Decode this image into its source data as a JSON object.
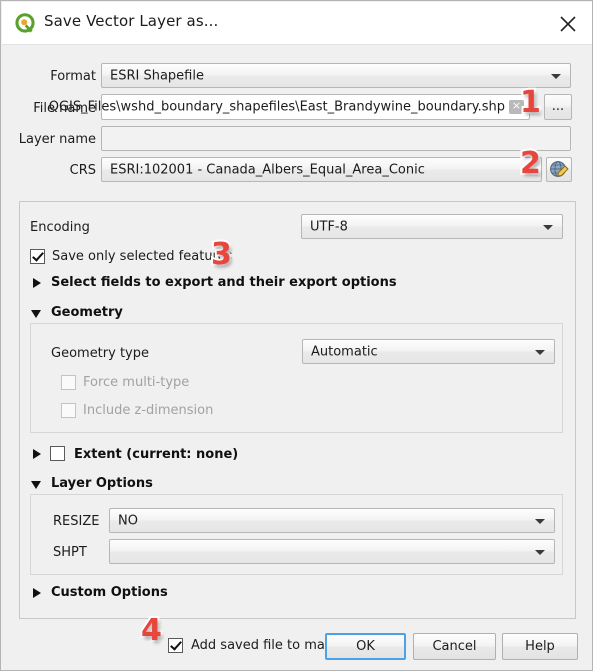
{
  "window": {
    "title": "Save Vector Layer as...",
    "logo_icon": "qgis-logo-icon",
    "close_icon": "close-icon"
  },
  "form": {
    "format": {
      "label": "Format",
      "value": "ESRI Shapefile"
    },
    "file_name": {
      "label": "File name",
      "value": "QGIS_Files\\wshd_boundary_shapefiles\\East_Brandywine_boundary.shp",
      "clear_icon": "clear-icon",
      "browse_label": "..."
    },
    "layer_name": {
      "label": "Layer name",
      "value": "",
      "placeholder": ""
    },
    "crs": {
      "label": "CRS",
      "value": "ESRI:102001 - Canada_Albers_Equal_Area_Conic",
      "select_icon": "globe-edit-icon"
    }
  },
  "options": {
    "encoding": {
      "label": "Encoding",
      "value": "UTF-8"
    },
    "save_only_selected": {
      "label": "Save only selected features",
      "checked": true
    },
    "select_fields": {
      "label": "Select fields to export and their export options",
      "expanded": false
    },
    "geometry": {
      "title": "Geometry",
      "expanded": true,
      "geometry_type": {
        "label": "Geometry type",
        "value": "Automatic"
      },
      "force_multi_type": {
        "label": "Force multi-type",
        "checked": false,
        "disabled": true
      },
      "include_z": {
        "label": "Include z-dimension",
        "checked": false,
        "disabled": true
      }
    },
    "extent": {
      "label": "Extent (current: none)",
      "checked": false,
      "expanded": false
    },
    "layer_options": {
      "title": "Layer Options",
      "expanded": true,
      "resize": {
        "label": "RESIZE",
        "value": "NO"
      },
      "shpt": {
        "label": "SHPT",
        "value": ""
      }
    },
    "custom_options": {
      "title": "Custom Options",
      "expanded": false
    }
  },
  "footer": {
    "add_to_map": {
      "label": "Add saved file to map",
      "checked": true
    },
    "ok_label": "OK",
    "cancel_label": "Cancel",
    "help_label": "Help"
  },
  "annotations": [
    {
      "number": "1"
    },
    {
      "number": "2"
    },
    {
      "number": "3"
    },
    {
      "number": "4"
    }
  ],
  "colors": {
    "annotation_red": "#e8453c",
    "focus_blue": "#4aa3e8",
    "dialog_bg": "#f0f0f0",
    "qgis_green": "#5aa02c",
    "qgis_orange": "#f0a330"
  }
}
